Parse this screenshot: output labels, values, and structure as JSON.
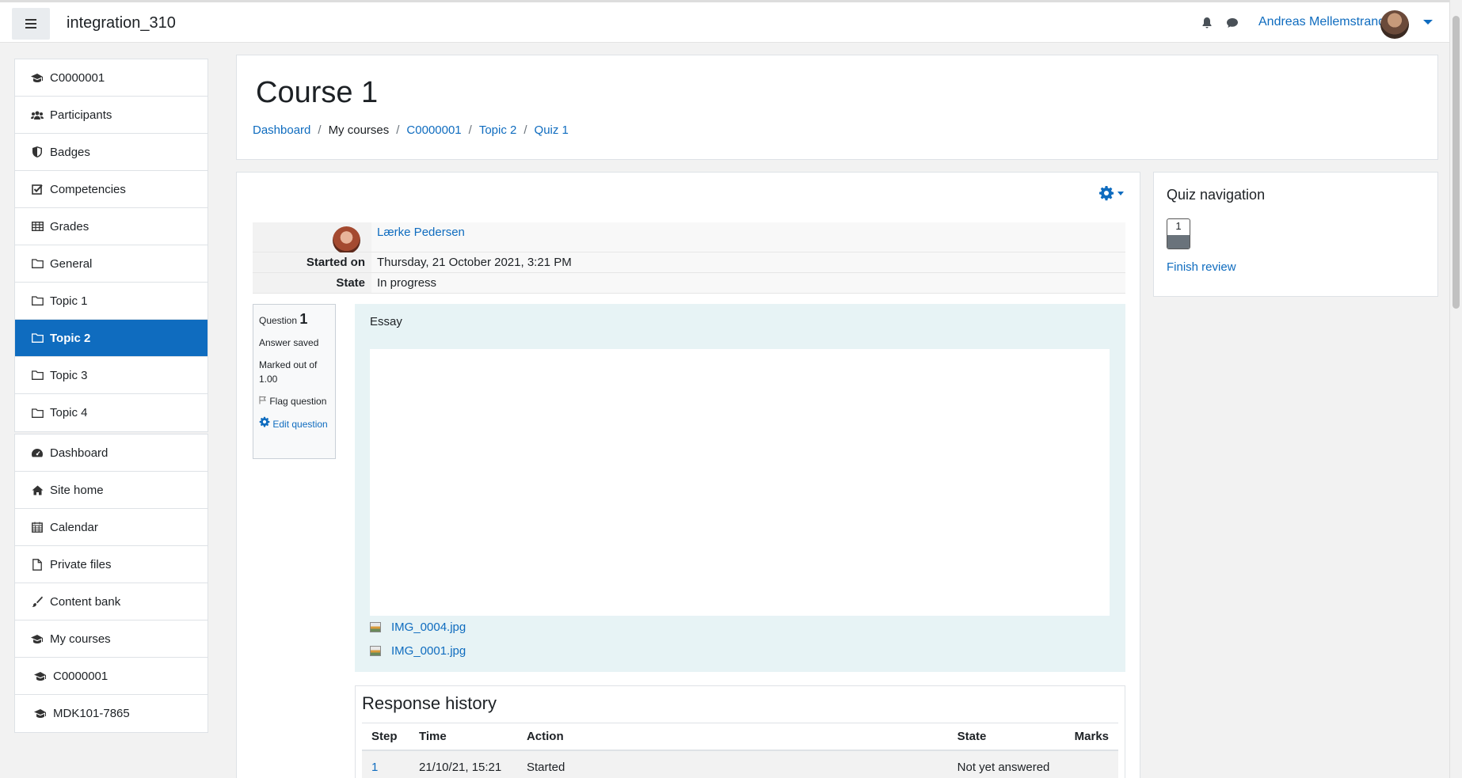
{
  "navbar": {
    "site_name": "integration_310",
    "user_name": "Andreas Mellemstrand",
    "icons": [
      "menu-icon",
      "bell-icon",
      "message-icon"
    ]
  },
  "drawer": {
    "course_items": [
      {
        "label": "C0000001",
        "icon": "graduation-cap-icon"
      },
      {
        "label": "Participants",
        "icon": "users-icon"
      },
      {
        "label": "Badges",
        "icon": "shield-icon"
      },
      {
        "label": "Competencies",
        "icon": "check-square-icon"
      },
      {
        "label": "Grades",
        "icon": "table-icon"
      },
      {
        "label": "General",
        "icon": "folder-icon"
      },
      {
        "label": "Topic 1",
        "icon": "folder-icon"
      },
      {
        "label": "Topic 2",
        "icon": "folder-icon"
      },
      {
        "label": "Topic 3",
        "icon": "folder-icon"
      },
      {
        "label": "Topic 4",
        "icon": "folder-icon"
      }
    ],
    "site_items": [
      {
        "label": "Dashboard",
        "icon": "dashboard-icon"
      },
      {
        "label": "Site home",
        "icon": "home-icon"
      },
      {
        "label": "Calendar",
        "icon": "calendar-icon"
      },
      {
        "label": "Private files",
        "icon": "file-icon"
      },
      {
        "label": "Content bank",
        "icon": "paint-brush-icon"
      },
      {
        "label": "My courses",
        "icon": "graduation-cap-icon"
      },
      {
        "label": "C0000001",
        "icon": "graduation-cap-icon"
      },
      {
        "label": "MDK101-7865",
        "icon": "graduation-cap-icon"
      }
    ],
    "active_item": "Topic 2"
  },
  "header": {
    "title": "Course 1",
    "breadcrumb": [
      "Dashboard",
      "My courses",
      "C0000001",
      "Topic 2",
      "Quiz 1"
    ]
  },
  "summary": {
    "student_name": "Lærke Pedersen",
    "started_on_label": "Started on",
    "started_on_value": "Thursday, 21 October 2021, 3:21 PM",
    "state_label": "State",
    "state_value": "In progress"
  },
  "question": {
    "label": "Question",
    "number": "1",
    "status": "Answer saved",
    "marked_out_of": "Marked out of 1.00",
    "flag_label": "Flag question",
    "edit_label": "Edit question",
    "text": "Essay",
    "attachments": [
      "IMG_0004.jpg",
      "IMG_0001.jpg"
    ]
  },
  "history": {
    "title": "Response history",
    "columns": [
      "Step",
      "Time",
      "Action",
      "State",
      "Marks"
    ],
    "rows": [
      [
        "1",
        "21/10/21, 15:21",
        "Started",
        "Not yet answered",
        ""
      ]
    ]
  },
  "quiz_nav": {
    "title": "Quiz navigation",
    "buttons": [
      "1"
    ],
    "finish_label": "Finish review"
  }
}
